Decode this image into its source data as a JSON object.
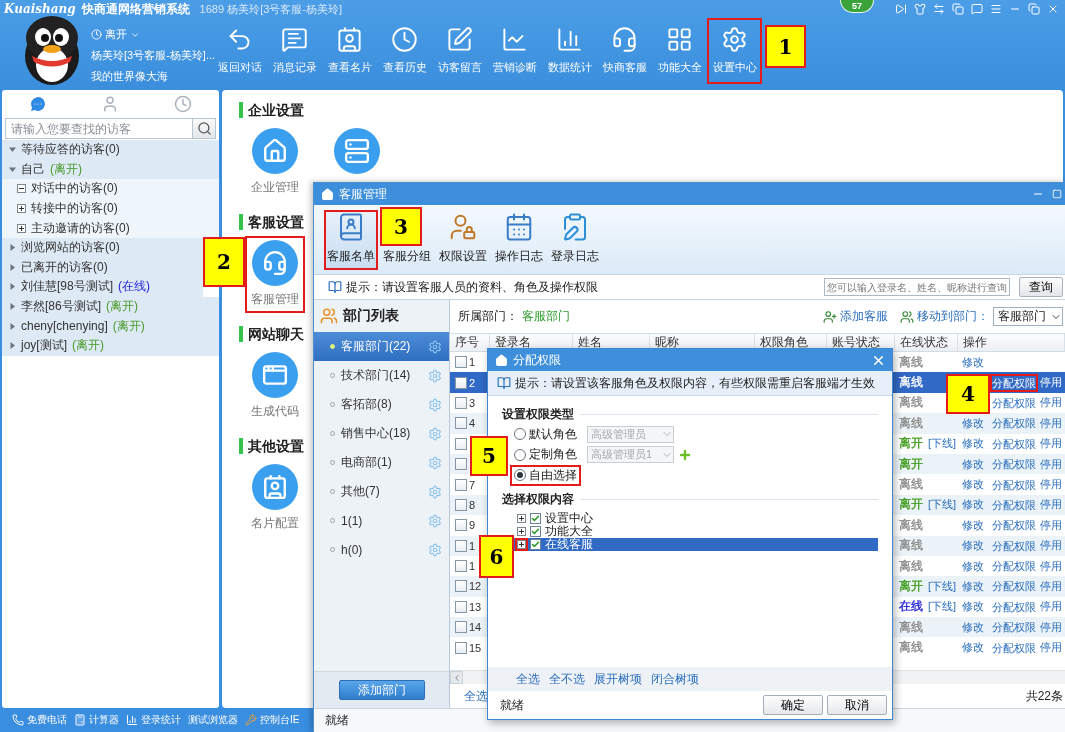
{
  "app_header": {
    "logo": "Kuaishang",
    "app_name": "快商通网络营销系统",
    "account": "1689 杨美玲[3号客服-杨美玲]",
    "badge": "57"
  },
  "profile": {
    "status": "离开",
    "name": "杨美玲[3号客服-杨美玲]...",
    "signature": "我的世界像大海"
  },
  "toolbar": [
    {
      "label": "返回对话",
      "marked": false
    },
    {
      "label": "消息记录",
      "marked": false
    },
    {
      "label": "查看名片",
      "marked": false
    },
    {
      "label": "查看历史",
      "marked": false
    },
    {
      "label": "访客留言",
      "marked": false
    },
    {
      "label": "营销诊断",
      "marked": false
    },
    {
      "label": "数据统计",
      "marked": false
    },
    {
      "label": "快商客服",
      "marked": false
    },
    {
      "label": "功能大全",
      "marked": false
    },
    {
      "label": "设置中心",
      "marked": true
    }
  ],
  "visitor_panel": {
    "tabs": [
      {
        "selected": true
      },
      {
        "selected": false
      },
      {
        "selected": false
      }
    ],
    "search": {
      "placeholder": "请输入您要查找的访客"
    },
    "tree": [
      {
        "label": "等待应答的访客(0)",
        "expanded": true
      },
      {
        "label": "自己",
        "status": {
          "text": "(离开)",
          "color": "#4a9a2a"
        },
        "expanded": true,
        "children": [
          {
            "label": "对话中的访客(0)",
            "expanded": true
          },
          {
            "label": "转接中的访客(0)",
            "expanded": false
          },
          {
            "label": "主动邀请的访客(0)",
            "expanded": false
          }
        ]
      },
      {
        "label": "浏览网站的访客(0)",
        "expanded": false
      },
      {
        "label": "已离开的访客(0)",
        "expanded": false
      },
      {
        "label": "刘佳慧[98号测试]",
        "status": {
          "text": "(在线)",
          "color": "#2424d8"
        },
        "expanded": false
      },
      {
        "label": "李然[86号测试]",
        "status": {
          "text": "(离开)",
          "color": "#4a9a2a"
        },
        "expanded": false
      },
      {
        "label": "cheny[chenying]",
        "status": {
          "text": "(离开)",
          "color": "#4a9a2a"
        },
        "expanded": false
      },
      {
        "label": "joy[测试]",
        "status": {
          "text": "(离开)",
          "color": "#4a9a2a"
        },
        "expanded": false
      }
    ]
  },
  "settings": [
    {
      "title": "企业设置",
      "items": [
        {
          "label": "企业管理",
          "marked": false
        },
        {
          "marked": false
        }
      ]
    },
    {
      "title": "客服设置",
      "items": [
        {
          "label": "客服管理",
          "marked": true
        }
      ]
    },
    {
      "title": "网站聊天",
      "items": [
        {
          "label": "生成代码",
          "marked": false
        }
      ]
    },
    {
      "title": "其他设置",
      "items": [
        {
          "label": "名片配置",
          "marked": false
        }
      ]
    }
  ],
  "bottom_bar": [
    "免费电话",
    "计算器",
    "登录统计",
    "测试浏览器",
    "控制台IE"
  ],
  "staff_window": {
    "title": "客服管理",
    "tools": [
      {
        "label": "客服名单",
        "selected": true,
        "marked": true
      },
      {
        "label": "客服分组",
        "selected": false,
        "marked": false
      },
      {
        "label": "权限设置",
        "selected": false,
        "marked": false
      },
      {
        "label": "操作日志",
        "selected": false,
        "marked": false
      },
      {
        "label": "登录日志",
        "selected": false,
        "marked": false
      }
    ],
    "hint": "提示：请设置客服人员的资料、角色及操作权限",
    "search": {
      "placeholder": "您可以输入登录名、姓名、昵称进行查询"
    },
    "search_button": "查询",
    "departments_title": "部门列表",
    "departments": [
      {
        "label": "客服部门(22)",
        "selected": true
      },
      {
        "label": "技术部门(14)",
        "selected": false
      },
      {
        "label": "客拓部(8)",
        "selected": false
      },
      {
        "label": "销售中心(18)",
        "selected": false
      },
      {
        "label": "电商部(1)",
        "selected": false
      },
      {
        "label": "其他(7)",
        "selected": false
      },
      {
        "label": "1(1)",
        "selected": false
      },
      {
        "label": "h(0)",
        "selected": false
      }
    ],
    "add_department": "添加部门",
    "filter_label": "所属部门：",
    "filter_value": "客服部门",
    "add_staff": "添加客服",
    "move_label": "移动到部门：",
    "move_select": "客服部门",
    "columns": [
      "序号",
      "登录名",
      "姓名",
      "昵称",
      "权限角色",
      "账号状态",
      "在线状态",
      "操作"
    ],
    "rows": [
      {
        "no": "1",
        "selected": false,
        "online": {
          "text": "离线",
          "color": "#8a8a8a"
        },
        "edit": "修改"
      },
      {
        "no": "2",
        "selected": true,
        "online": {
          "text": "离线"
        },
        "assign": "分配权限",
        "assign_marked": true,
        "disable": "停用"
      },
      {
        "no": "3",
        "selected": false,
        "online": {
          "text": "离线",
          "color": "#8a8a8a"
        },
        "assign": "分配权限",
        "assign_marked": false,
        "disable": "停用"
      },
      {
        "no": "4",
        "selected": false,
        "online": {
          "text": "离线",
          "color": "#8a8a8a"
        },
        "edit": "修改",
        "assign": "分配权限",
        "assign_marked": false,
        "disable": "停用"
      },
      {
        "selected": false,
        "online": {
          "text": "离开",
          "color": "#3c9b1a"
        },
        "logout": "[下线]",
        "edit": "修改",
        "assign": "分配权限",
        "assign_marked": false,
        "disable": "停用"
      },
      {
        "selected": false,
        "online": {
          "text": "离开",
          "color": "#3c9b1a"
        },
        "edit": "修改",
        "assign": "分配权限",
        "assign_marked": false,
        "disable": "停用"
      },
      {
        "no": "7",
        "selected": false,
        "online": {
          "text": "离线",
          "color": "#8a8a8a"
        },
        "edit": "修改",
        "assign": "分配权限",
        "assign_marked": false,
        "disable": "停用"
      },
      {
        "no": "8",
        "selected": false,
        "online": {
          "text": "离开",
          "color": "#3c9b1a"
        },
        "logout": "[下线]",
        "edit": "修改",
        "assign": "分配权限",
        "assign_marked": false,
        "disable": "停用"
      },
      {
        "no": "9",
        "selected": false,
        "online": {
          "text": "离线",
          "color": "#8a8a8a"
        },
        "edit": "修改",
        "assign": "分配权限",
        "assign_marked": false,
        "disable": "停用"
      },
      {
        "no": "1",
        "selected": false,
        "online": {
          "text": "离线",
          "color": "#8a8a8a"
        },
        "edit": "修改",
        "assign": "分配权限",
        "assign_marked": false,
        "disable": "停用"
      },
      {
        "no": "1",
        "selected": false,
        "online": {
          "text": "离线",
          "color": "#8a8a8a"
        },
        "edit": "修改",
        "assign": "分配权限",
        "assign_marked": false,
        "disable": "停用"
      },
      {
        "no": "12",
        "selected": false,
        "online": {
          "text": "离开",
          "color": "#3c9b1a"
        },
        "logout": "[下线]",
        "edit": "修改",
        "assign": "分配权限",
        "assign_marked": false,
        "disable": "停用"
      },
      {
        "no": "13",
        "selected": false,
        "online": {
          "text": "在线",
          "color": "#2424d8"
        },
        "logout": "[下线]",
        "edit": "修改",
        "assign": "分配权限",
        "assign_marked": false,
        "disable": "停用"
      },
      {
        "no": "14",
        "selected": false,
        "online": {
          "text": "离线",
          "color": "#8a8a8a"
        },
        "edit": "修改",
        "assign": "分配权限",
        "assign_marked": false,
        "disable": "停用"
      },
      {
        "no": "15",
        "selected": false,
        "online": {
          "text": "离线",
          "color": "#8a8a8a"
        },
        "edit": "修改",
        "assign": "分配权限",
        "assign_marked": false,
        "disable": "停用"
      }
    ],
    "select_all": "全选",
    "total": "共22条",
    "status": "就绪"
  },
  "permission_dialog": {
    "title": "分配权限",
    "hint": "提示：请设置该客服角色及权限内容，有些权限需重启客服端才生效",
    "type_heading": "设置权限类型",
    "options": [
      {
        "label": "默认角色",
        "selected": false,
        "marked": false,
        "select": "高级管理员",
        "add": false
      },
      {
        "label": "定制角色",
        "selected": false,
        "marked": false,
        "select": "高级管理员1",
        "add": true
      },
      {
        "label": "自由选择",
        "selected": true,
        "marked": true
      }
    ],
    "content_heading": "选择权限内容",
    "tree": [
      {
        "label": "设置中心",
        "checked": true,
        "expanded": false,
        "selected": false,
        "marked": false
      },
      {
        "label": "功能大全",
        "checked": true,
        "expanded": false,
        "selected": false,
        "marked": false
      },
      {
        "label": "在线客服",
        "checked": true,
        "expanded": false,
        "selected": true,
        "marked": true
      }
    ],
    "links": [
      "全选",
      "全不选",
      "展开树项",
      "闭合树项"
    ],
    "status": "就绪",
    "buttons": [
      "确定",
      "取消"
    ]
  },
  "annotations": [
    "1",
    "2",
    "3",
    "4",
    "5",
    "6"
  ]
}
